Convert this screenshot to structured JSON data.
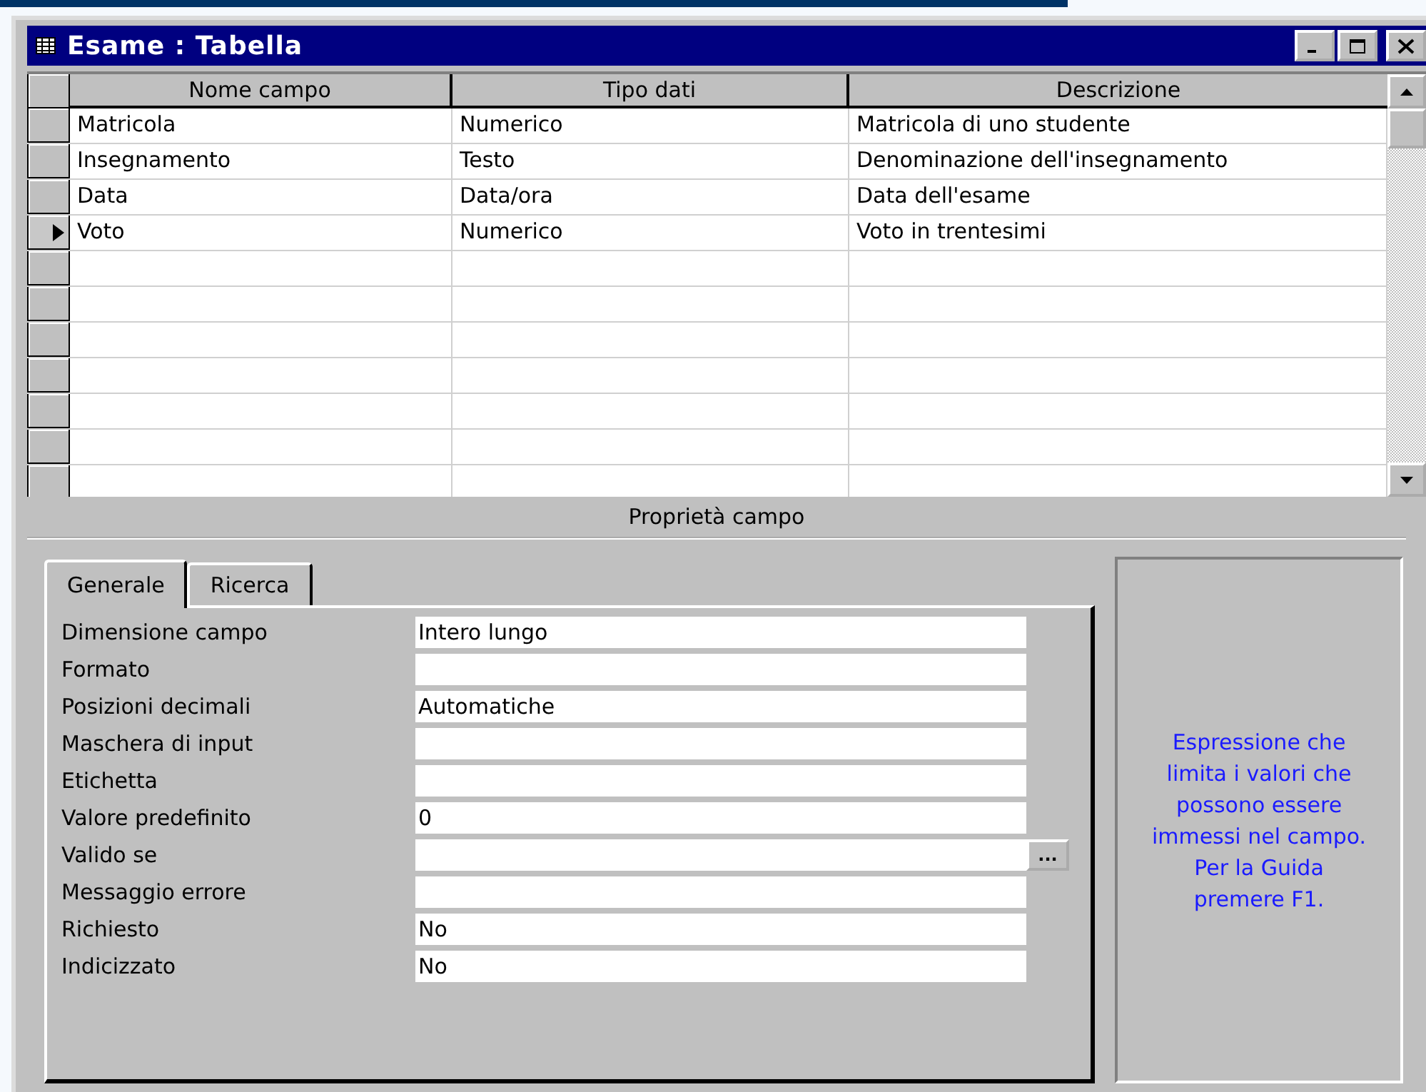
{
  "window": {
    "title": "Esame : Tabella"
  },
  "table": {
    "columns": [
      "Nome campo",
      "Tipo dati",
      "Descrizione"
    ],
    "rows": [
      {
        "cells": [
          "Matricola",
          "Numerico",
          "Matricola di uno studente"
        ],
        "current": false
      },
      {
        "cells": [
          "Insegnamento",
          "Testo",
          "Denominazione dell'insegnamento"
        ],
        "current": false
      },
      {
        "cells": [
          "Data",
          "Data/ora",
          "Data dell'esame"
        ],
        "current": false
      },
      {
        "cells": [
          "Voto",
          "Numerico",
          "Voto in trentesimi"
        ],
        "current": true
      }
    ]
  },
  "properties_section": {
    "title": "Proprietà campo"
  },
  "tabs": [
    {
      "label": "Generale",
      "selected": true
    },
    {
      "label": "Ricerca",
      "selected": false
    }
  ],
  "properties": [
    {
      "label": "Dimensione campo",
      "value": "Intero lungo",
      "builder": false
    },
    {
      "label": "Formato",
      "builder": false
    },
    {
      "label": "Posizioni decimali",
      "value": "Automatiche",
      "builder": false
    },
    {
      "label": "Maschera di input",
      "builder": false
    },
    {
      "label": "Etichetta",
      "builder": false
    },
    {
      "label": "Valore predefinito",
      "value": "0",
      "builder": false
    },
    {
      "label": "Valido se",
      "builder": true,
      "builder_label": "..."
    },
    {
      "label": "Messaggio errore",
      "builder": false
    },
    {
      "label": "Richiesto",
      "value": "No",
      "builder": false
    },
    {
      "label": "Indicizzato",
      "value": "No",
      "builder": false
    }
  ],
  "help_text": "Espressione che limita i valori che possono essere immessi nel campo. Per la Guida premere F1."
}
